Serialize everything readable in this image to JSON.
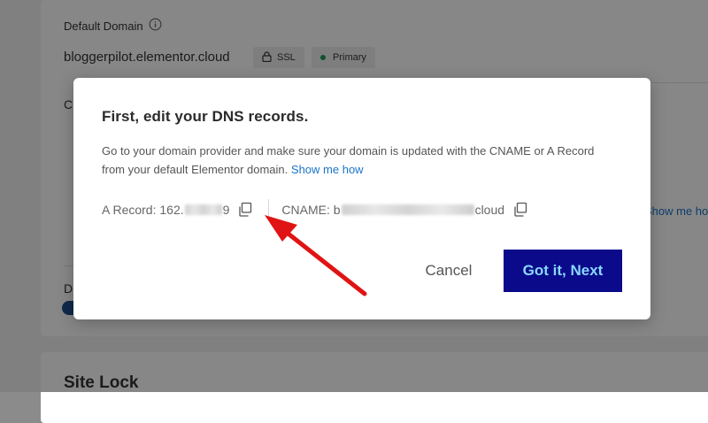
{
  "background": {
    "default_domain_label": "Default Domain",
    "domain": "bloggerpilot.elementor.cloud",
    "ssl_badge": "SSL",
    "primary_badge": "Primary",
    "fragment_c": "C",
    "fragment_d": "D",
    "show_me_how_fragment": "Show me how",
    "site_lock_title": "Site Lock"
  },
  "modal": {
    "title": "First, edit your DNS records.",
    "description": "Go to your domain provider and make sure your domain is updated with the CNAME or A Record from your default Elementor domain.",
    "show_me_how": "Show me how",
    "a_record_label": "A Record:",
    "a_record_prefix": "162.",
    "a_record_suffix": "9",
    "cname_label": "CNAME:",
    "cname_prefix": "b",
    "cname_suffix": "cloud",
    "cancel_label": "Cancel",
    "next_label": "Got it, Next"
  },
  "colors": {
    "primary_button_bg": "#0a0a8a",
    "primary_button_text": "#8ad8ff",
    "link": "#1a73c9",
    "primary_dot": "#1a9e5c",
    "annotation_arrow": "#e01414"
  },
  "icons": {
    "copy": "copy-icon",
    "info": "info-icon",
    "lock": "lock-icon",
    "arrow": "annotation-arrow-icon"
  }
}
